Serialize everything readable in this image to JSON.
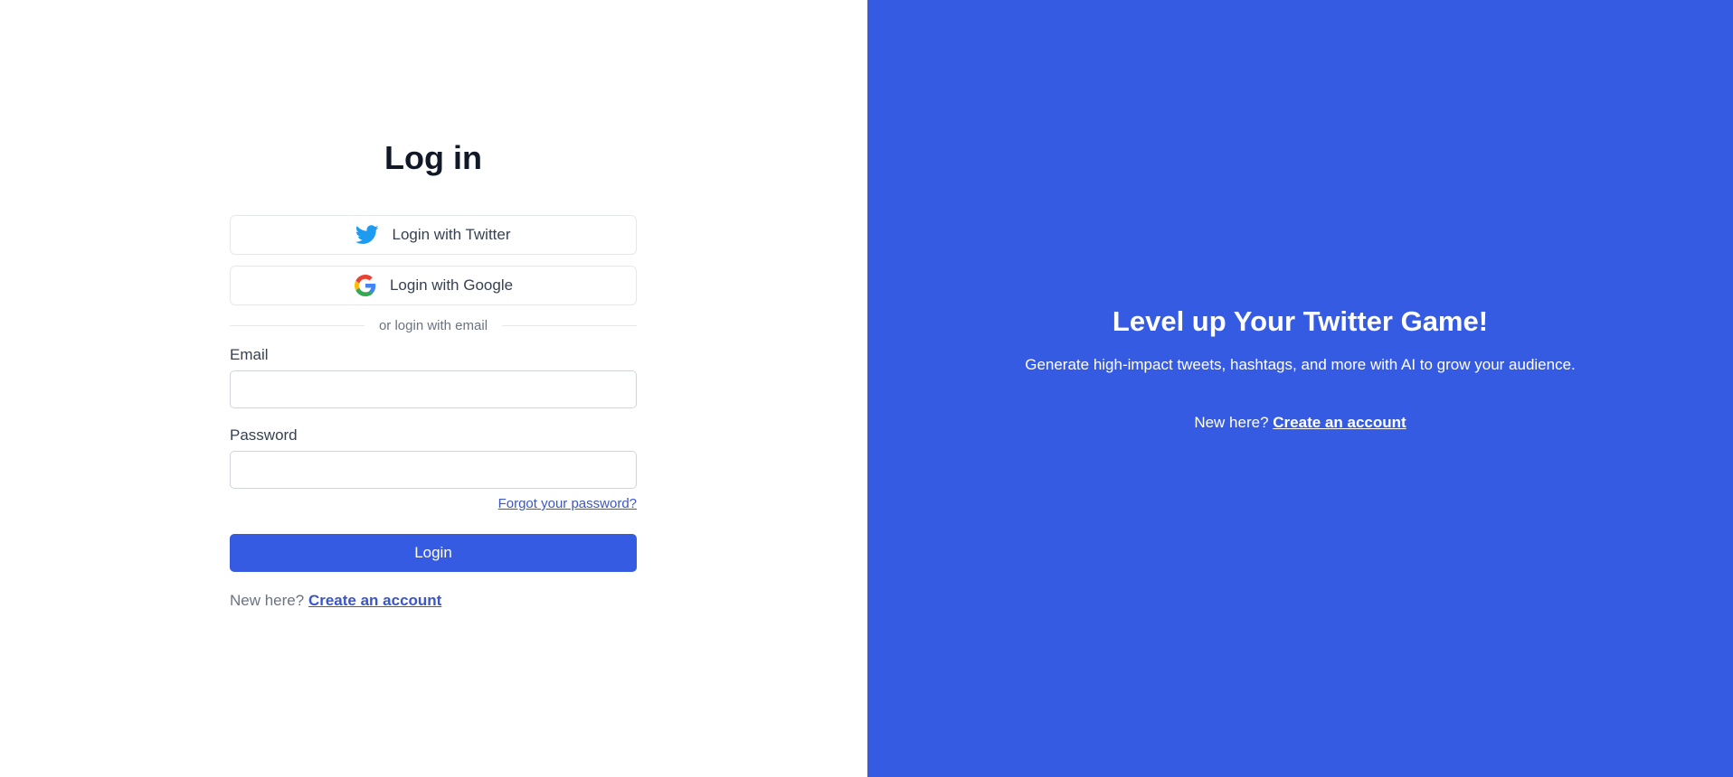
{
  "login": {
    "title": "Log in",
    "twitter_button": "Login with Twitter",
    "google_button": "Login with Google",
    "divider_text": "or login with email",
    "email_label": "Email",
    "email_value": "",
    "password_label": "Password",
    "password_value": "",
    "forgot_link": "Forgot your password?",
    "submit_label": "Login",
    "new_here_text": "New here?",
    "create_account_link": "Create an account"
  },
  "promo": {
    "title": "Level up Your Twitter Game!",
    "subtitle": "Generate high-impact tweets, hashtags, and more with AI to grow your audience.",
    "new_here_text": "New here?",
    "create_account_link": "Create an account"
  },
  "colors": {
    "accent": "#365be3",
    "link": "#3b56c8",
    "twitter": "#1d9bf0"
  },
  "icons": {
    "twitter": "twitter-bird-icon",
    "google": "google-g-icon"
  }
}
